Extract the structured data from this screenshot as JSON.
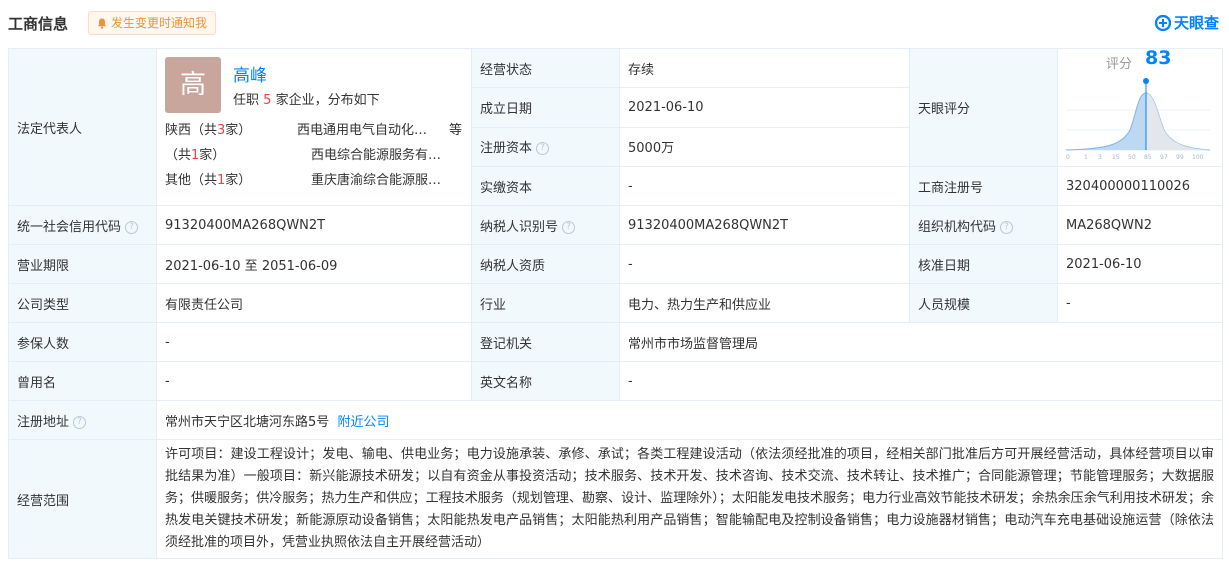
{
  "header": {
    "title": "工商信息",
    "notify_label": "发生变更时通知我",
    "logo_text": "天眼查"
  },
  "legal_person": {
    "label": "法定代表人",
    "avatar_char": "高",
    "name": "高峰",
    "sub_prefix": "任职",
    "sub_count": "5",
    "sub_suffix": "家企业，分布如下",
    "rows": [
      {
        "region_prefix": "陕西（共",
        "count": "3",
        "region_suffix": "家）",
        "company": "西电通用电气自动化…"
      },
      {
        "region_prefix": "（共",
        "count": "1",
        "region_suffix": "家）",
        "company": "西电综合能源服务有…"
      },
      {
        "region_prefix": "其他（共",
        "count": "1",
        "region_suffix": "家）",
        "company": "重庆唐渝综合能源服…"
      }
    ],
    "deng": "等"
  },
  "fields": {
    "status_label": "经营状态",
    "status_value": "存续",
    "found_label": "成立日期",
    "found_value": "2021-06-10",
    "capital_label": "注册资本",
    "capital_value": "5000万",
    "paid_label": "实缴资本",
    "paid_value": "-",
    "score_label": "天眼评分",
    "reg_no_label": "工商注册号",
    "reg_no_value": "320400000110026",
    "credit_label": "统一社会信用代码",
    "credit_value": "91320400MA268QWN2T",
    "tax_label": "纳税人识别号",
    "tax_value": "91320400MA268QWN2T",
    "org_label": "组织机构代码",
    "org_value": "MA268QWN2",
    "term_label": "营业期限",
    "term_value": "2021-06-10 至 2051-06-09",
    "tax_q_label": "纳税人资质",
    "tax_q_value": "-",
    "approve_label": "核准日期",
    "approve_value": "2021-06-10",
    "type_label": "公司类型",
    "type_value": "有限责任公司",
    "industry_label": "行业",
    "industry_value": "电力、热力生产和供应业",
    "staff_label": "人员规模",
    "staff_value": "-",
    "insured_label": "参保人数",
    "insured_value": "-",
    "authority_label": "登记机关",
    "authority_value": "常州市市场监督管理局",
    "former_label": "曾用名",
    "former_value": "-",
    "en_label": "英文名称",
    "en_value": "-",
    "addr_label": "注册地址",
    "addr_value": "常州市天宁区北塘河东路5号",
    "addr_link": "附近公司",
    "scope_label": "经营范围",
    "scope_value": "许可项目：建设工程设计；发电、输电、供电业务；电力设施承装、承修、承试；各类工程建设活动（依法须经批准的项目，经相关部门批准后方可开展经营活动，具体经营项目以审批结果为准）一般项目：新兴能源技术研发；以自有资金从事投资活动；技术服务、技术开发、技术咨询、技术交流、技术转让、技术推广；合同能源管理；节能管理服务；大数据服务；供暖服务；供冷服务；热力生产和供应；工程技术服务（规划管理、勘察、设计、监理除外）；太阳能发电技术服务；电力行业高效节能技术研发；余热余压余气利用技术研发；余热发电关键技术研发；新能源原动设备销售；太阳能热发电产品销售；太阳能热利用产品销售；智能输配电及控制设备销售；电力设施器材销售；电动汽车充电基础设施运营（除依法须经批准的项目外，凭营业执照依法自主开展经营活动）"
  },
  "score": {
    "label": "评分",
    "value": "83",
    "ticks": [
      "0",
      "1",
      "3",
      "15",
      "50",
      "85",
      "97",
      "99",
      "100"
    ]
  },
  "colors": {
    "accent": "#0084ff",
    "label_bg": "#f2f9fc",
    "border": "#e4eef6"
  }
}
